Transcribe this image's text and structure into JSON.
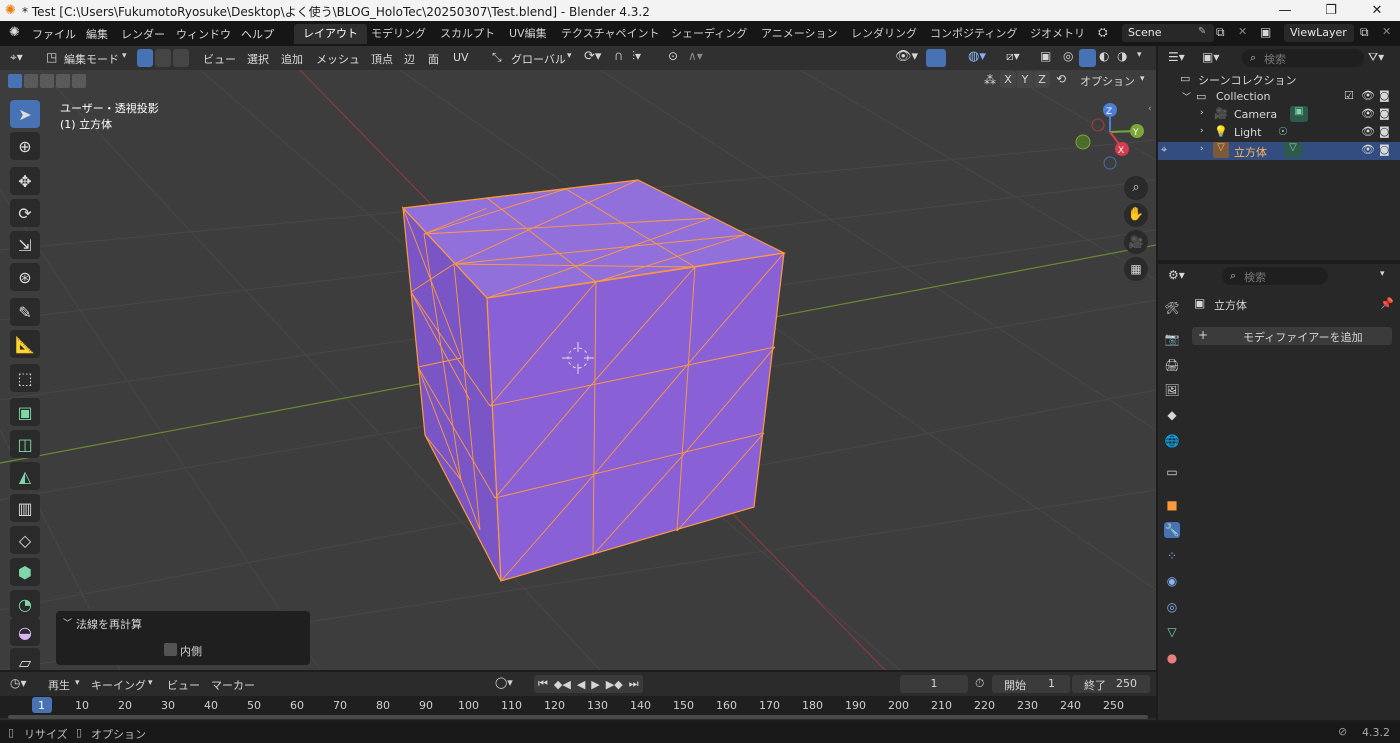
{
  "window": {
    "title": "* Test [C:\\Users\\FukumotoRyosuke\\Desktop\\よく使う\\BLOG_HoloTec\\20250307\\Test.blend] - Blender 4.3.2",
    "minimize": "—",
    "maximize": "❐",
    "close": "✕"
  },
  "menu": [
    "ファイル",
    "編集",
    "レンダー",
    "ウィンドウ",
    "ヘルプ"
  ],
  "workspaces": [
    "レイアウト",
    "モデリング",
    "スカルプト",
    "UV編集",
    "テクスチャペイント",
    "シェーディング",
    "アニメーション",
    "レンダリング",
    "コンポジティング",
    "ジオメトリ"
  ],
  "scene": "Scene",
  "view_layer": "ViewLayer",
  "viewport_header": {
    "mode": "編集モード",
    "menus": [
      "ビュー",
      "選択",
      "追加",
      "メッシュ",
      "頂点",
      "辺",
      "面",
      "UV"
    ],
    "transform_orientation": "グローバル",
    "axes": [
      "X",
      "Y",
      "Z"
    ],
    "options": "オプション"
  },
  "viewport": {
    "view_name": "ユーザー・透視投影",
    "object_info": "(1) 立方体",
    "face_color": "#8a60d6",
    "edge_color": "#ff9a3c",
    "gizmo": {
      "x": "X",
      "y": "Y",
      "z": "Z"
    }
  },
  "operator_panel": {
    "title": "法線を再計算",
    "checkbox_label": "内側",
    "checked": false
  },
  "outliner": {
    "search_placeholder": "検索",
    "root": "シーンコレクション",
    "collection": "Collection",
    "items": [
      {
        "name": "Camera"
      },
      {
        "name": "Light"
      },
      {
        "name": "立方体",
        "selected": true
      }
    ]
  },
  "properties": {
    "search_placeholder": "検索",
    "object_name": "立方体",
    "add_modifier": "モディファイアーを追加"
  },
  "timeline": {
    "menus": [
      "再生",
      "キーイング",
      "ビュー",
      "マーカー"
    ],
    "current_frame": "1",
    "start_label": "開始",
    "start": "1",
    "end_label": "終了",
    "end": "250",
    "ruler": [
      "1",
      "10",
      "20",
      "30",
      "40",
      "50",
      "60",
      "70",
      "80",
      "90",
      "100",
      "110",
      "120",
      "130",
      "140",
      "150",
      "160",
      "170",
      "180",
      "190",
      "200",
      "210",
      "220",
      "230",
      "240",
      "250"
    ]
  },
  "statusbar": {
    "left1": "リサイズ",
    "left2": "オプション",
    "version": "4.3.2"
  }
}
